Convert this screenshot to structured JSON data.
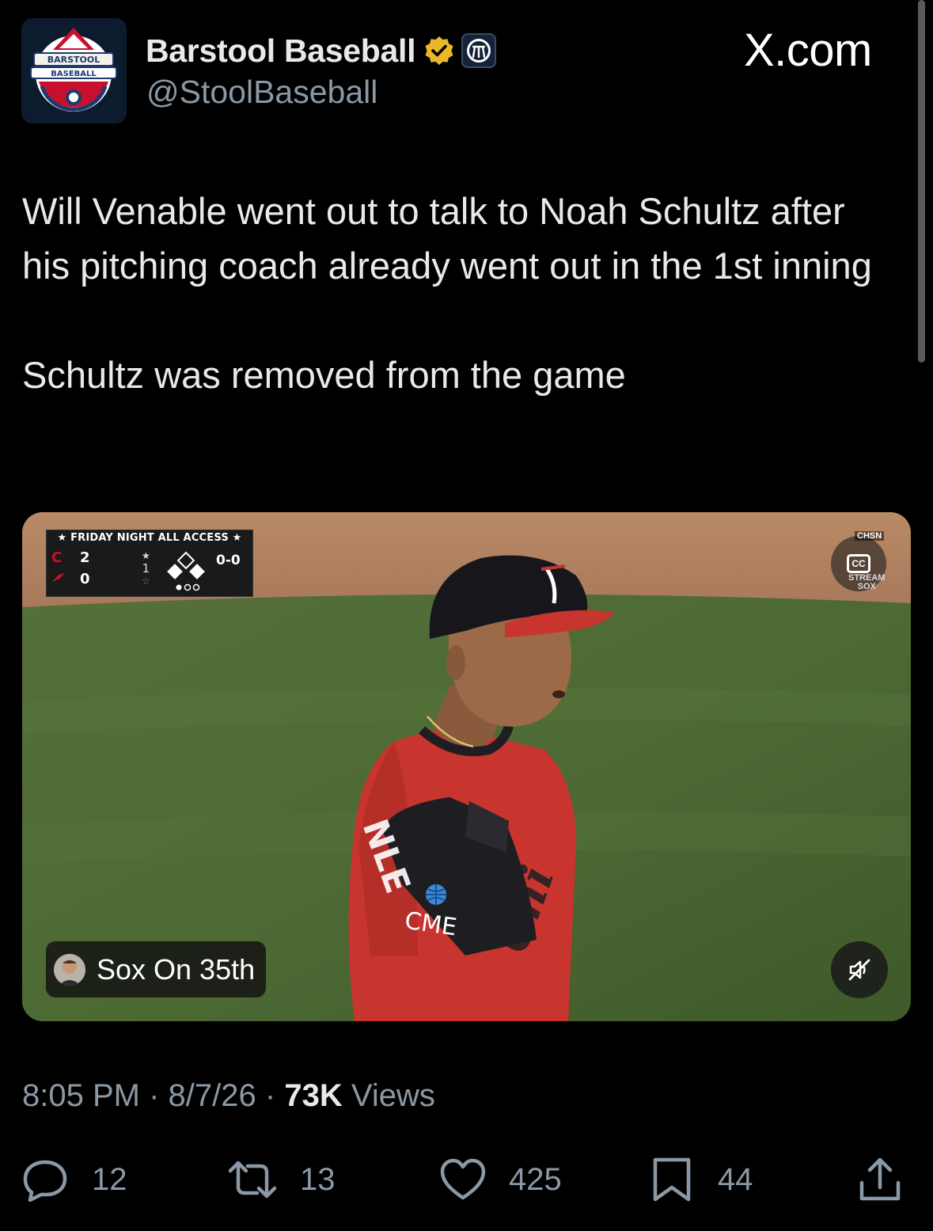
{
  "tweet": {
    "display_name": "Barstool Baseball",
    "handle": "@StoolBaseball",
    "source_label": "X.com",
    "avatar_text": {
      "top": "BARSTOOL",
      "bottom": "BASEBALL"
    },
    "text_line1": "Will Venable went out to talk to Noah Schultz after his pitching coach already went out in the 1st inning",
    "text_line2": "Schultz was removed from the game",
    "verified_icon": "verified-badge-icon",
    "affiliate_icon": "barstool-affiliate-icon"
  },
  "media": {
    "scorebug": {
      "title": "★ FRIDAY NIGHT ALL ACCESS ★",
      "team1_logo": "C",
      "team1_score": "2",
      "team2_score": "0",
      "inning": "1",
      "count": "0-0"
    },
    "overlay": {
      "network": "CHSN",
      "stream_label_1": "STREAM",
      "stream_label_2": "SOX",
      "cc_label": "CC"
    },
    "jersey_patch": "CME",
    "chip_label": "Sox On 35th"
  },
  "meta": {
    "time": "8:05 PM",
    "sep1": "·",
    "date": "8/7/26",
    "sep2": "·",
    "views_count": "73K",
    "views_label": "Views"
  },
  "actions": {
    "replies": "12",
    "reposts": "13",
    "likes": "425",
    "bookmarks": "44"
  },
  "colors": {
    "background": "#000000",
    "text_primary": "#e7e9ea",
    "text_secondary": "#8b98a5",
    "verified_gold": "#e8b829"
  }
}
